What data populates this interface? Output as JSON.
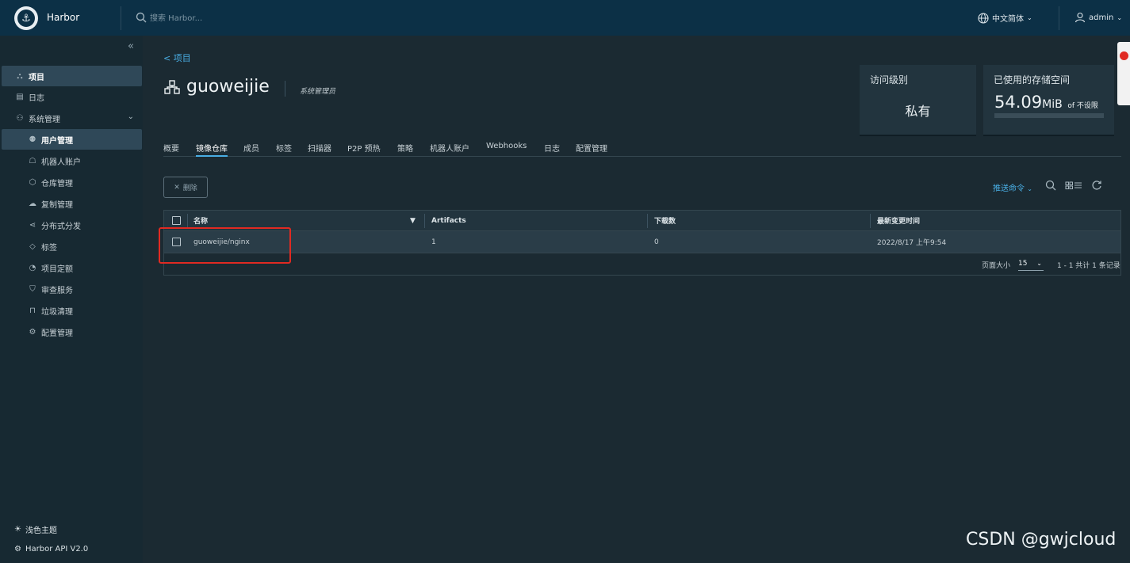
{
  "header": {
    "brand": "Harbor",
    "search_placeholder": "搜索 Harbor...",
    "language": "中文简体",
    "user": "admin"
  },
  "sidebar": {
    "items": [
      {
        "label": "项目",
        "icon": "project-icon",
        "active": true
      },
      {
        "label": "日志",
        "icon": "log-icon"
      },
      {
        "label": "系统管理",
        "icon": "admin-icon",
        "expandable": true
      },
      {
        "label": "用户管理",
        "icon": "users-icon",
        "active": true
      },
      {
        "label": "机器人账户",
        "icon": "robot-icon"
      },
      {
        "label": "仓库管理",
        "icon": "registry-icon"
      },
      {
        "label": "复制管理",
        "icon": "replication-icon"
      },
      {
        "label": "分布式分发",
        "icon": "distribution-icon"
      },
      {
        "label": "标签",
        "icon": "tag-icon"
      },
      {
        "label": "项目定额",
        "icon": "quota-icon"
      },
      {
        "label": "审查服务",
        "icon": "shield-icon"
      },
      {
        "label": "垃圾清理",
        "icon": "trash-icon"
      },
      {
        "label": "配置管理",
        "icon": "gear-icon"
      }
    ],
    "footer": {
      "theme": "浅色主题",
      "api": "Harbor API V2.0"
    }
  },
  "main": {
    "breadcrumb": "< 项目",
    "project_name": "guoweijie",
    "role": "系统管理员",
    "access_card": {
      "title": "访问级别",
      "value": "私有"
    },
    "storage_card": {
      "title": "已使用的存储空间",
      "value": "54.09",
      "unit": "MiB",
      "of": "of 不设限"
    },
    "tabs": [
      "概要",
      "镜像仓库",
      "成员",
      "标签",
      "扫描器",
      "P2P 预热",
      "策略",
      "机器人账户",
      "Webhooks",
      "日志",
      "配置管理"
    ],
    "active_tab": "镜像仓库",
    "delete_label": "删除",
    "push_command": "推送命令",
    "table": {
      "headers": [
        "名称",
        "Artifacts",
        "下载数",
        "最新变更时间"
      ],
      "rows": [
        {
          "name": "guoweijie/nginx",
          "artifacts": "1",
          "downloads": "0",
          "updated": "2022/8/17 上午9:54"
        }
      ],
      "page_size_label": "页面大小",
      "page_size": "15",
      "summary": "1 - 1 共计 1 条记录"
    }
  },
  "watermark": "CSDN @gwjcloud"
}
